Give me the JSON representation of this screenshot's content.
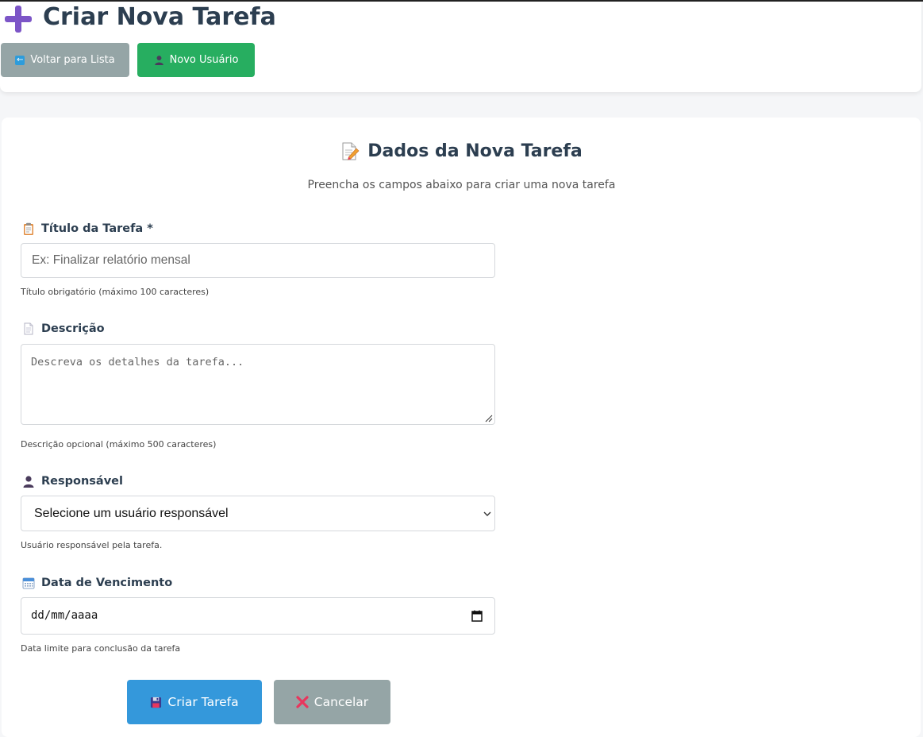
{
  "header": {
    "title": "Criar Nova Tarefa",
    "buttons": {
      "back_label": "Voltar para Lista",
      "new_user_label": "Novo Usuário"
    }
  },
  "form": {
    "heading": "Dados da Nova Tarefa",
    "subtitle": "Preencha os campos abaixo para criar uma nova tarefa",
    "title_field": {
      "label": "Título da Tarefa *",
      "value": "",
      "placeholder": "Ex: Finalizar relatório mensal",
      "help": "Título obrigatório (máximo 100 caracteres)"
    },
    "description_field": {
      "label": "Descrição",
      "value": "",
      "placeholder": "Descreva os detalhes da tarefa...",
      "help": "Descrição opcional (máximo 500 caracteres)"
    },
    "responsible_field": {
      "label": "Responsável",
      "selected": "Selecione um usuário responsável",
      "help": "Usuário responsável pela tarefa."
    },
    "due_date_field": {
      "label": "Data de Vencimento",
      "placeholder": "dd/mm/aaaa",
      "help": "Data limite para conclusão da tarefa"
    },
    "actions": {
      "submit_label": "Criar Tarefa",
      "cancel_label": "Cancelar"
    }
  },
  "icons": {
    "page_title": "plus-icon",
    "back": "arrow-left-icon",
    "new_user": "user-icon",
    "heading": "memo-icon",
    "title_label": "clipboard-icon",
    "description_label": "document-icon",
    "responsible_label": "user-icon",
    "due_date_label": "calendar-icon",
    "submit": "floppy-disk-icon",
    "cancel": "cross-mark-icon"
  },
  "colors": {
    "primary": "#3498db",
    "success": "#27ae60",
    "secondary": "#95a5a6",
    "title_text": "#2c3e50",
    "accent_plus": "#7c55c7",
    "cancel_icon": "#e8365d"
  }
}
